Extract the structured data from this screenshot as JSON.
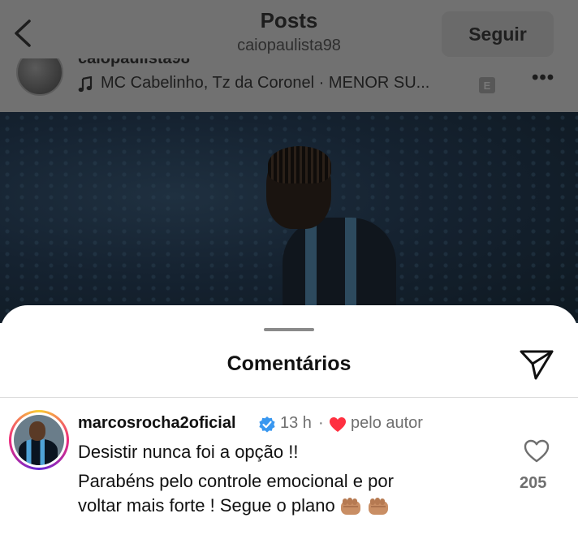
{
  "header": {
    "title": "Posts",
    "username": "caiopaulista98",
    "follow_label": "Seguir",
    "back_icon": "chevron-left-icon"
  },
  "post": {
    "author": "caiopaulista98",
    "music": "MC Cabelinho, Tz da Coronel · MENOR SU...",
    "explicit_badge": "E",
    "more_label": "•••"
  },
  "comments_sheet": {
    "title": "Comentários",
    "share_icon": "send-icon"
  },
  "comment": {
    "username": "marcosrocha2oficial",
    "verified": true,
    "time": "13 h",
    "separator": "·",
    "liked_by_author": "pelo autor",
    "line1": "Desistir nunca foi a opção !!",
    "line2": "Parabéns pelo controle emocional e por",
    "line3": "voltar mais forte ! Segue o plano",
    "like_count": "205"
  },
  "colors": {
    "overlay_gray": "#717171",
    "heart_red": "#ff3040",
    "verified_blue": "#3897f0",
    "meta_gray": "#6f6f6f"
  }
}
